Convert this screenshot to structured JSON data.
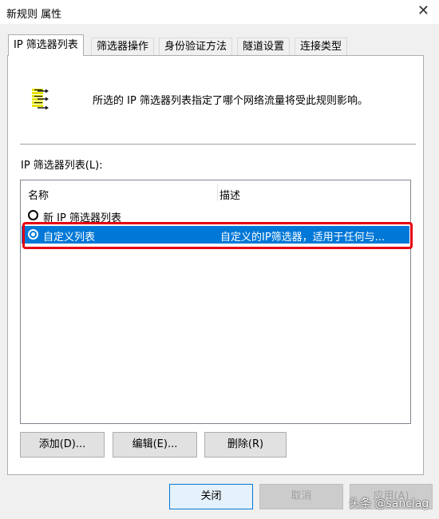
{
  "window": {
    "title": "新规则 属性",
    "close_glyph": "✕"
  },
  "tabs": [
    {
      "label": "IP 筛选器列表",
      "active": true
    },
    {
      "label": "筛选器操作",
      "active": false
    },
    {
      "label": "身份验证方法",
      "active": false
    },
    {
      "label": "隧道设置",
      "active": false
    },
    {
      "label": "连接类型",
      "active": false
    }
  ],
  "info": {
    "icon": "filter-list-icon",
    "text": "所选的 IP 筛选器列表指定了哪个网络流量将受此规则影响。"
  },
  "list": {
    "label": "IP 筛选器列表(L):",
    "columns": [
      "名称",
      "描述"
    ],
    "rows": [
      {
        "name": "新 IP 筛选器列表",
        "desc": "",
        "selected": false
      },
      {
        "name": "自定义列表",
        "desc": "自定义的IP筛选器，适用于任何与...",
        "selected": true
      }
    ],
    "highlight_color": "#e60012",
    "selection_color": "#0078d7"
  },
  "panel_buttons": {
    "add": "添加(D)...",
    "edit": "编辑(E)...",
    "delete": "删除(R)"
  },
  "footer_buttons": {
    "close": "关闭",
    "cancel": "取消",
    "apply": "应用(A)"
  },
  "watermark": "头条 @sanclag"
}
